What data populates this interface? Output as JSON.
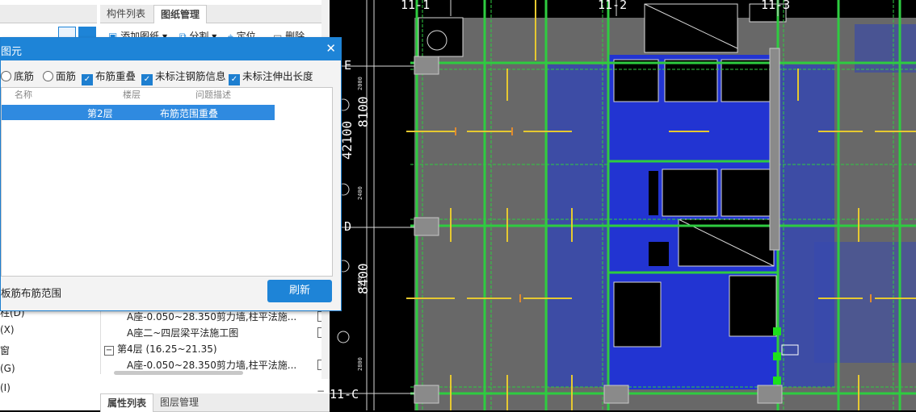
{
  "left_panel": {
    "tabs": {
      "component_list": "构件列表",
      "drawing_manage": "图纸管理"
    },
    "toolbar": {
      "add_drawing": "添加图纸",
      "split": "分割",
      "locate": "定位",
      "delete": "删除"
    },
    "left_items": [
      "柱(D)",
      "(X)",
      "窗",
      "(G)",
      "(I)"
    ],
    "tree": {
      "row1": "A座-0.050~28.350剪力墙,柱平法施...",
      "row2": "A座二~四层梁平法施工图",
      "floor4": "第4层 (16.25~21.35)",
      "row3": "A座-0.050~28.350剪力墙,柱平法施..."
    },
    "bottom_tabs": {
      "properties": "属性列表",
      "layers": "图层管理"
    }
  },
  "dialog": {
    "title": "图元",
    "options": {
      "bottom_rebar": "底筋",
      "top_rebar": "面筋",
      "overlap": "布筋重叠",
      "unlabeled_info": "未标注钢筋信息",
      "unlabeled_length": "未标注伸出长度"
    },
    "columns": {
      "name": "名称",
      "floor": "楼层",
      "problem": "问题描述"
    },
    "row": {
      "floor": "第2层",
      "problem": "布筋范围重叠"
    },
    "footer_label": "板筋布筋范围",
    "refresh_label": "刷新",
    "accent": "#1e84d7"
  },
  "cad": {
    "grid_labels": {
      "c1": "11-1",
      "c2": "11-2",
      "c3": "11-3",
      "rE": "1-E",
      "rD": "1-D",
      "rC": "11-C"
    },
    "dims": {
      "d1": "8100",
      "d2": "8400",
      "d3": "42100"
    },
    "colors": {
      "slab": "#6a6a6a",
      "highlight": "#2a3fe0",
      "beam": "#2ecc40",
      "rebar": "#e6c830"
    }
  }
}
